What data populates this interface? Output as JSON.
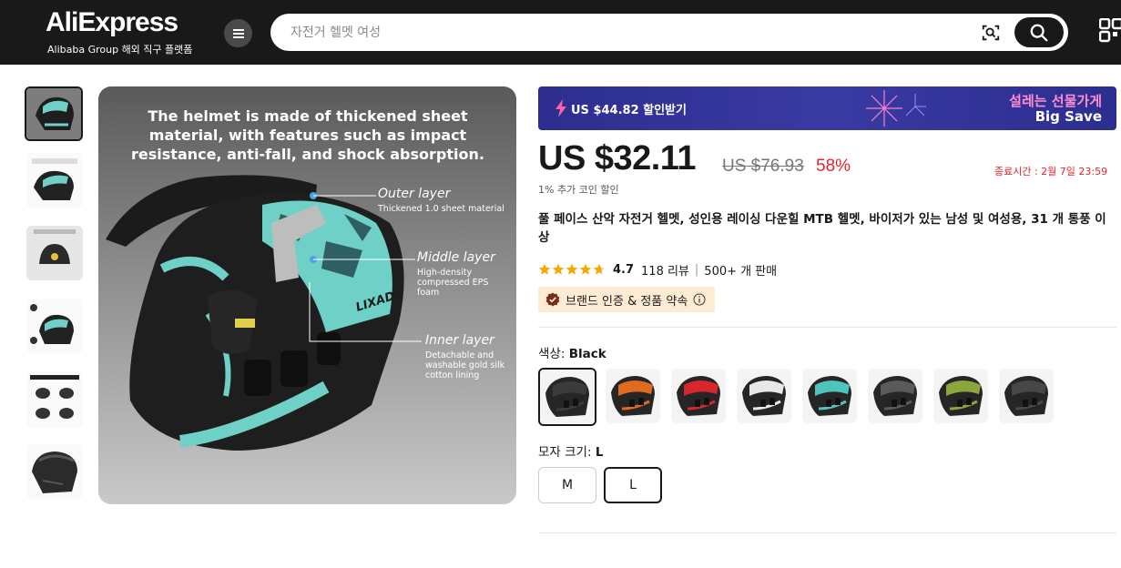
{
  "header": {
    "logo": "AliExpress",
    "logo_sub": "Alibaba Group 해외 직구 플랫폼",
    "search_placeholder": "자전거 헬멧 여성"
  },
  "gallery": {
    "thumbnail_count": 6,
    "main_image": {
      "headline": "The helmet is made of thickened sheet material, with features such as impact resistance, anti-fall, and shock absorption.",
      "layers": [
        {
          "title": "Outer layer",
          "desc": "Thickened 1.0 sheet material"
        },
        {
          "title": "Middle layer",
          "desc": "High-density compressed EPS foam"
        },
        {
          "title": "Inner layer",
          "desc": "Detachable and washable gold silk cotton lining"
        }
      ],
      "brand_mark": "LIXADA"
    }
  },
  "promo": {
    "coupon": "US $44.82 할인받기",
    "line1": "설레는 선물가게",
    "line2": "Big Save"
  },
  "pricing": {
    "price": "US $32.11",
    "old_price": "US $76.93",
    "discount": "58%",
    "end_time": "종료시간 : 2월 7일 23:59",
    "coin_note": "1% 추가 코인 할인"
  },
  "product": {
    "title": "풀 페이스 산악 자전거 헬멧, 성인용 레이싱 다운힐 MTB 헬멧, 바이저가 있는 남성 및 여성용, 31 개 통풍 이상",
    "rating": "4.7",
    "stars": 4.7,
    "reviews": "118 리뷰",
    "sold": "500+ 개 판매",
    "badge": "브랜드 인증 & 정품 약속"
  },
  "color": {
    "label": "색상:",
    "selected": "Black",
    "options": [
      {
        "name": "black",
        "accent": "#3b3b3b"
      },
      {
        "name": "orange",
        "accent": "#e26a1f"
      },
      {
        "name": "red",
        "accent": "#d9262a"
      },
      {
        "name": "white",
        "accent": "#e8e8e8"
      },
      {
        "name": "teal",
        "accent": "#4fc3bd"
      },
      {
        "name": "grey",
        "accent": "#5a5a5a"
      },
      {
        "name": "camo",
        "accent": "#8ba63a"
      },
      {
        "name": "dark-grey",
        "accent": "#474747"
      }
    ]
  },
  "size": {
    "label": "모자 크기:",
    "selected": "L",
    "options": [
      "M",
      "L"
    ]
  },
  "colors": {
    "brand_dark": "#191919",
    "sale_red": "#e0262e",
    "teal": "#5ed4c8",
    "star": "#f7a600"
  }
}
